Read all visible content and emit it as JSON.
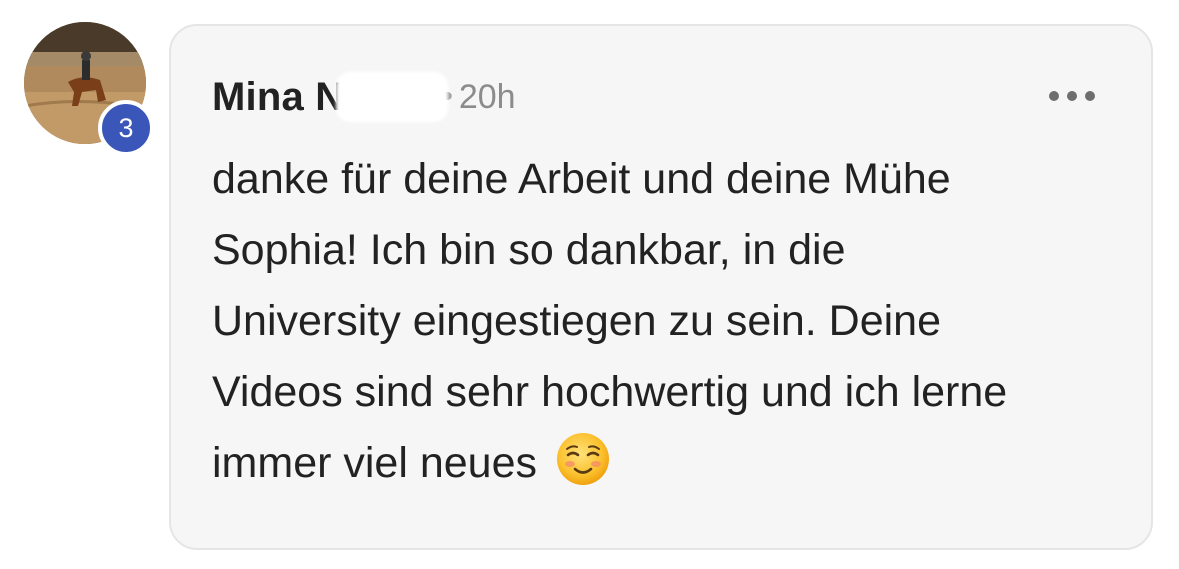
{
  "comment": {
    "author": {
      "name_visible": "Mina N",
      "level_badge": "3"
    },
    "timestamp_separator": "•",
    "timestamp": "20h",
    "more_icon": "ellipsis-horizontal-icon",
    "body_lines": [
      "danke für deine Arbeit und deine Mühe",
      "Sophia! Ich bin so dankbar, in die",
      "University eingestiegen zu sein. Deine",
      "Videos sind sehr hochwertig und ich lerne",
      "immer viel neues"
    ],
    "emoji": "smiling-face-icon"
  },
  "colors": {
    "card_background": "#f6f6f6",
    "card_border": "#e5e5e5",
    "badge_blue": "#3a56b8",
    "text_primary": "#222222",
    "text_muted": "#8c8c8c"
  }
}
